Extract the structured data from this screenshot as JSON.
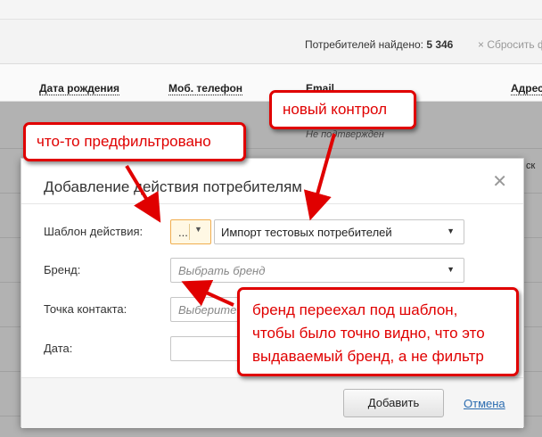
{
  "header": {
    "found_label": "Потребителей найдено:",
    "found_count": "5 346",
    "reset_label": "× Сбросить фи"
  },
  "table": {
    "columns": [
      "Дата рождения",
      "Моб. телефон",
      "Email",
      "Адрес"
    ],
    "row_muted_text": "Не подтвержден",
    "row_fragment": "ск"
  },
  "dialog": {
    "title": "Добавление действия потребителям",
    "close_icon": "close-icon",
    "template_label": "Шаблон действия:",
    "template_prefilter_value": "...",
    "template_value": "Импорт тестовых потребителей",
    "brand_label": "Бренд:",
    "brand_placeholder": "Выбрать бренд",
    "contact_label": "Точка контакта:",
    "contact_placeholder": "Выберите",
    "date_label": "Дата:",
    "date_value": "",
    "add_button": "Добавить",
    "cancel_link": "Отмена"
  },
  "annotations": {
    "prefiltered": "что-то предфильтровано",
    "new_control": "новый контрол",
    "brand_note_line1": "бренд переехал под шаблон,",
    "brand_note_line2": "чтобы было точно видно, что это",
    "brand_note_line3": "выдаваемый бренд, а не фильтр",
    "color": "#e00000"
  }
}
